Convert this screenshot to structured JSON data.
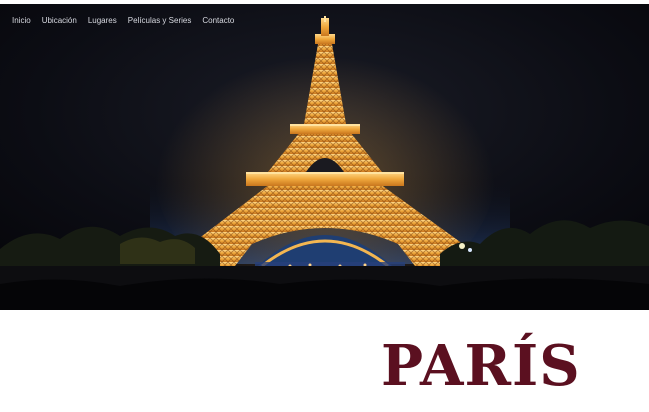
{
  "nav": {
    "items": [
      {
        "label": "Inicio"
      },
      {
        "label": "Ubicación"
      },
      {
        "label": "Lugares"
      },
      {
        "label": "Películas y Series"
      },
      {
        "label": "Contacto"
      }
    ]
  },
  "hero": {
    "image": "eiffel-tower-night-photo"
  },
  "title": {
    "text": "PARÍS"
  },
  "colors": {
    "title": "#5b1020",
    "nav_text": "#d7d9e0",
    "sky": "#0a0b10",
    "tower_light": "#f2b04a"
  }
}
